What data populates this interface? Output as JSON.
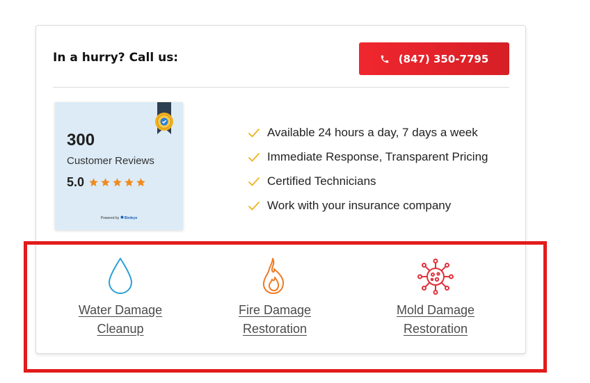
{
  "header": {
    "hurry_text": "In a hurry? Call us:",
    "phone": "(847) 350-7795",
    "phone_icon": "phone-icon",
    "button_color": "#e8232a"
  },
  "reviews": {
    "count": "300",
    "label": "Customer Reviews",
    "rating": "5.0",
    "stars": 5,
    "star_color": "#f08a1c",
    "powered_by": "Powered by",
    "brand": "Birdeye",
    "badge_icon": "ribbon-badge-icon"
  },
  "features": [
    {
      "text": "Available 24 hours a day, 7 days a week",
      "icon": "check-icon"
    },
    {
      "text": "Immediate Response, Transparent Pricing",
      "icon": "check-icon"
    },
    {
      "text": "Certified Technicians",
      "icon": "check-icon"
    },
    {
      "text": "Work with your insurance company",
      "icon": "check-icon"
    }
  ],
  "services": [
    {
      "line1": "Water Damage",
      "line2": "Cleanup",
      "icon": "water-drop-icon",
      "color": "#2a9fd6"
    },
    {
      "line1": "Fire Damage",
      "line2": "Restoration",
      "icon": "flame-icon",
      "color": "#f07a22"
    },
    {
      "line1": "Mold Damage",
      "line2": "Restoration",
      "icon": "mold-spore-icon",
      "color": "#e0303a"
    }
  ],
  "colors": {
    "accent_red": "#e21b1b",
    "check": "#f2b01e"
  }
}
